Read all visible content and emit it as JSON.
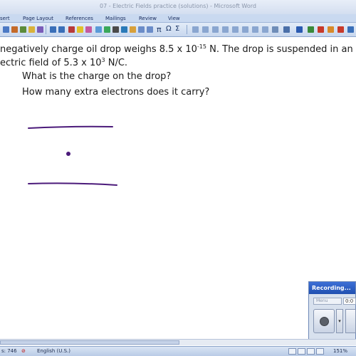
{
  "window": {
    "title": "07 - Electric Fields practice (solutions) - Microsoft Word"
  },
  "ribbon": {
    "tabs": [
      "sert",
      "Page Layout",
      "References",
      "Mailings",
      "Review",
      "View"
    ]
  },
  "toolbar": {
    "icons": [
      "save-icon",
      "undo-icon",
      "redo-icon",
      "pen-icon",
      "highlighter-icon",
      "eraser-icon",
      "insert-icon",
      "symbol-pi-icon",
      "omega-icon",
      "shapes-icon",
      "table-icon",
      "draw-icon"
    ],
    "glyphs": [
      "π",
      "Ω",
      "Σ"
    ]
  },
  "document": {
    "line1_pre": "negatively charge oil drop weighs 8.5 x 10",
    "line1_exp": "-15",
    "line1_post": " N.  The drop is suspended in an",
    "line2_pre": "ectric field of 5.3 x 10",
    "line2_exp": "3",
    "line2_post": " N/C.",
    "question1": "What is the charge on the drop?",
    "question2": "How many extra electrons does it carry?",
    "ink_color": "#4b1a7a"
  },
  "recording": {
    "title": "Recording...",
    "menu_label": "Menu",
    "time": "0:0"
  },
  "status": {
    "words": "s: 746",
    "language": "English (U.S.)",
    "zoom": "151%"
  }
}
